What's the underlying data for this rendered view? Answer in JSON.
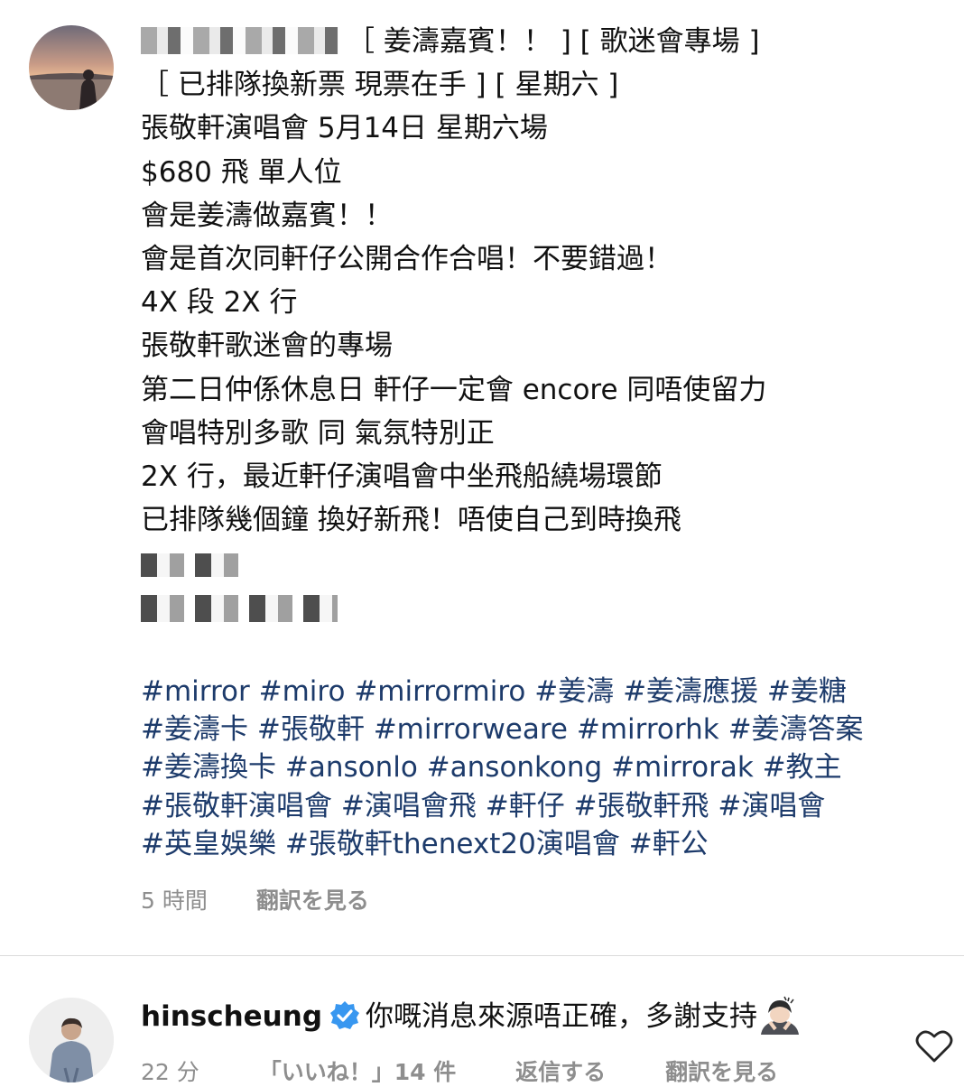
{
  "post": {
    "caption_first_line": "［ 姜濤嘉賓！！ ] [ 歌迷會專場 ]",
    "caption_lines": [
      "［ 已排隊換新票 現票在手 ] [ 星期六 ]",
      "張敬軒演唱會 5月14日 星期六場",
      "$680 飛 單人位",
      "會是姜濤做嘉賓！！",
      "會是首次同軒仔公開合作合唱！不要錯過！",
      "4X 段 2X 行",
      "張敬軒歌迷會的專場",
      "第二日仲係休息日 軒仔一定會 encore 同唔使留力",
      "會唱特別多歌 同 氣氛特別正",
      "2X 行，最近軒仔演唱會中坐飛船繞場環節",
      "已排隊幾個鐘 換好新飛！唔使自己到時換飛"
    ],
    "hashtags": [
      "#mirror",
      "#miro",
      "#mirrormiro",
      "#姜濤",
      "#姜濤應援",
      "#姜糖",
      "#姜濤卡",
      "#張敬軒",
      "#mirrorweare",
      "#mirrorhk",
      "#姜濤答案",
      "#姜濤換卡",
      "#ansonlo",
      "#ansonkong",
      "#mirrorak",
      "#教主",
      "#張敬軒演唱會",
      "#演唱會飛",
      "#軒仔",
      "#張敬軒飛",
      "#演唱會",
      "#英皇娛樂",
      "#張敬軒thenext20演唱會",
      "#軒公"
    ],
    "time": "5 時間",
    "translate": "翻訳を見る"
  },
  "reply": {
    "username": "hinscheung",
    "text": "你嘅消息來源唔正確，多謝支持",
    "time": "22 分",
    "likes": "「いいね！」14 件",
    "reply_label": "返信する",
    "translate": "翻訳を見る"
  },
  "colors": {
    "hashtag": "#1d3b6b",
    "meta": "#8e8e8e",
    "verified": "#3897f0",
    "divider": "#dbdbdb"
  },
  "icons": {
    "verified": "verified-badge-icon",
    "emoji": "person-bowing-emoji-icon",
    "heart": "heart-outline-icon"
  }
}
